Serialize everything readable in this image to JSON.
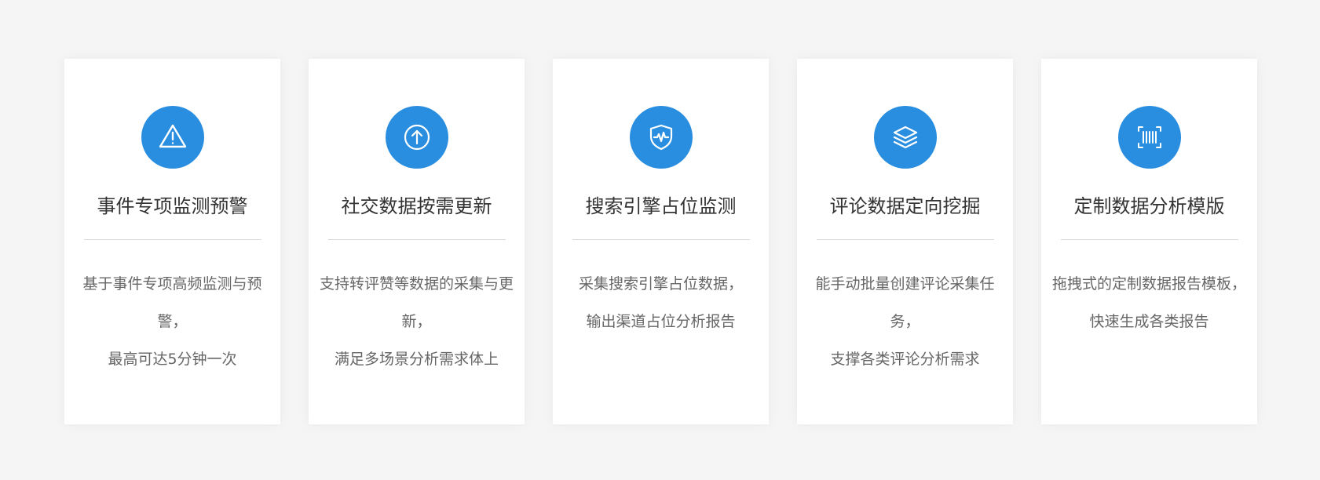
{
  "accent_color": "#2a8ee0",
  "cards": [
    {
      "icon": "warning-icon",
      "title": "事件专项监测预警",
      "lines": [
        "基于事件专项高频监测与预警，",
        "最高可达5分钟一次"
      ]
    },
    {
      "icon": "upload-arrow-icon",
      "title": "社交数据按需更新",
      "lines": [
        "支持转评赞等数据的采集与更新，",
        "满足多场景分析需求体上"
      ]
    },
    {
      "icon": "shield-pulse-icon",
      "title": "搜索引擎占位监测",
      "lines": [
        "采集搜索引擎占位数据，",
        "输出渠道占位分析报告"
      ]
    },
    {
      "icon": "layers-icon",
      "title": "评论数据定向挖掘",
      "lines": [
        "能手动批量创建评论采集任务，",
        "支撑各类评论分析需求"
      ]
    },
    {
      "icon": "barcode-scan-icon",
      "title": "定制数据分析模版",
      "lines": [
        "拖拽式的定制数据报告模板，",
        "快速生成各类报告"
      ]
    }
  ]
}
